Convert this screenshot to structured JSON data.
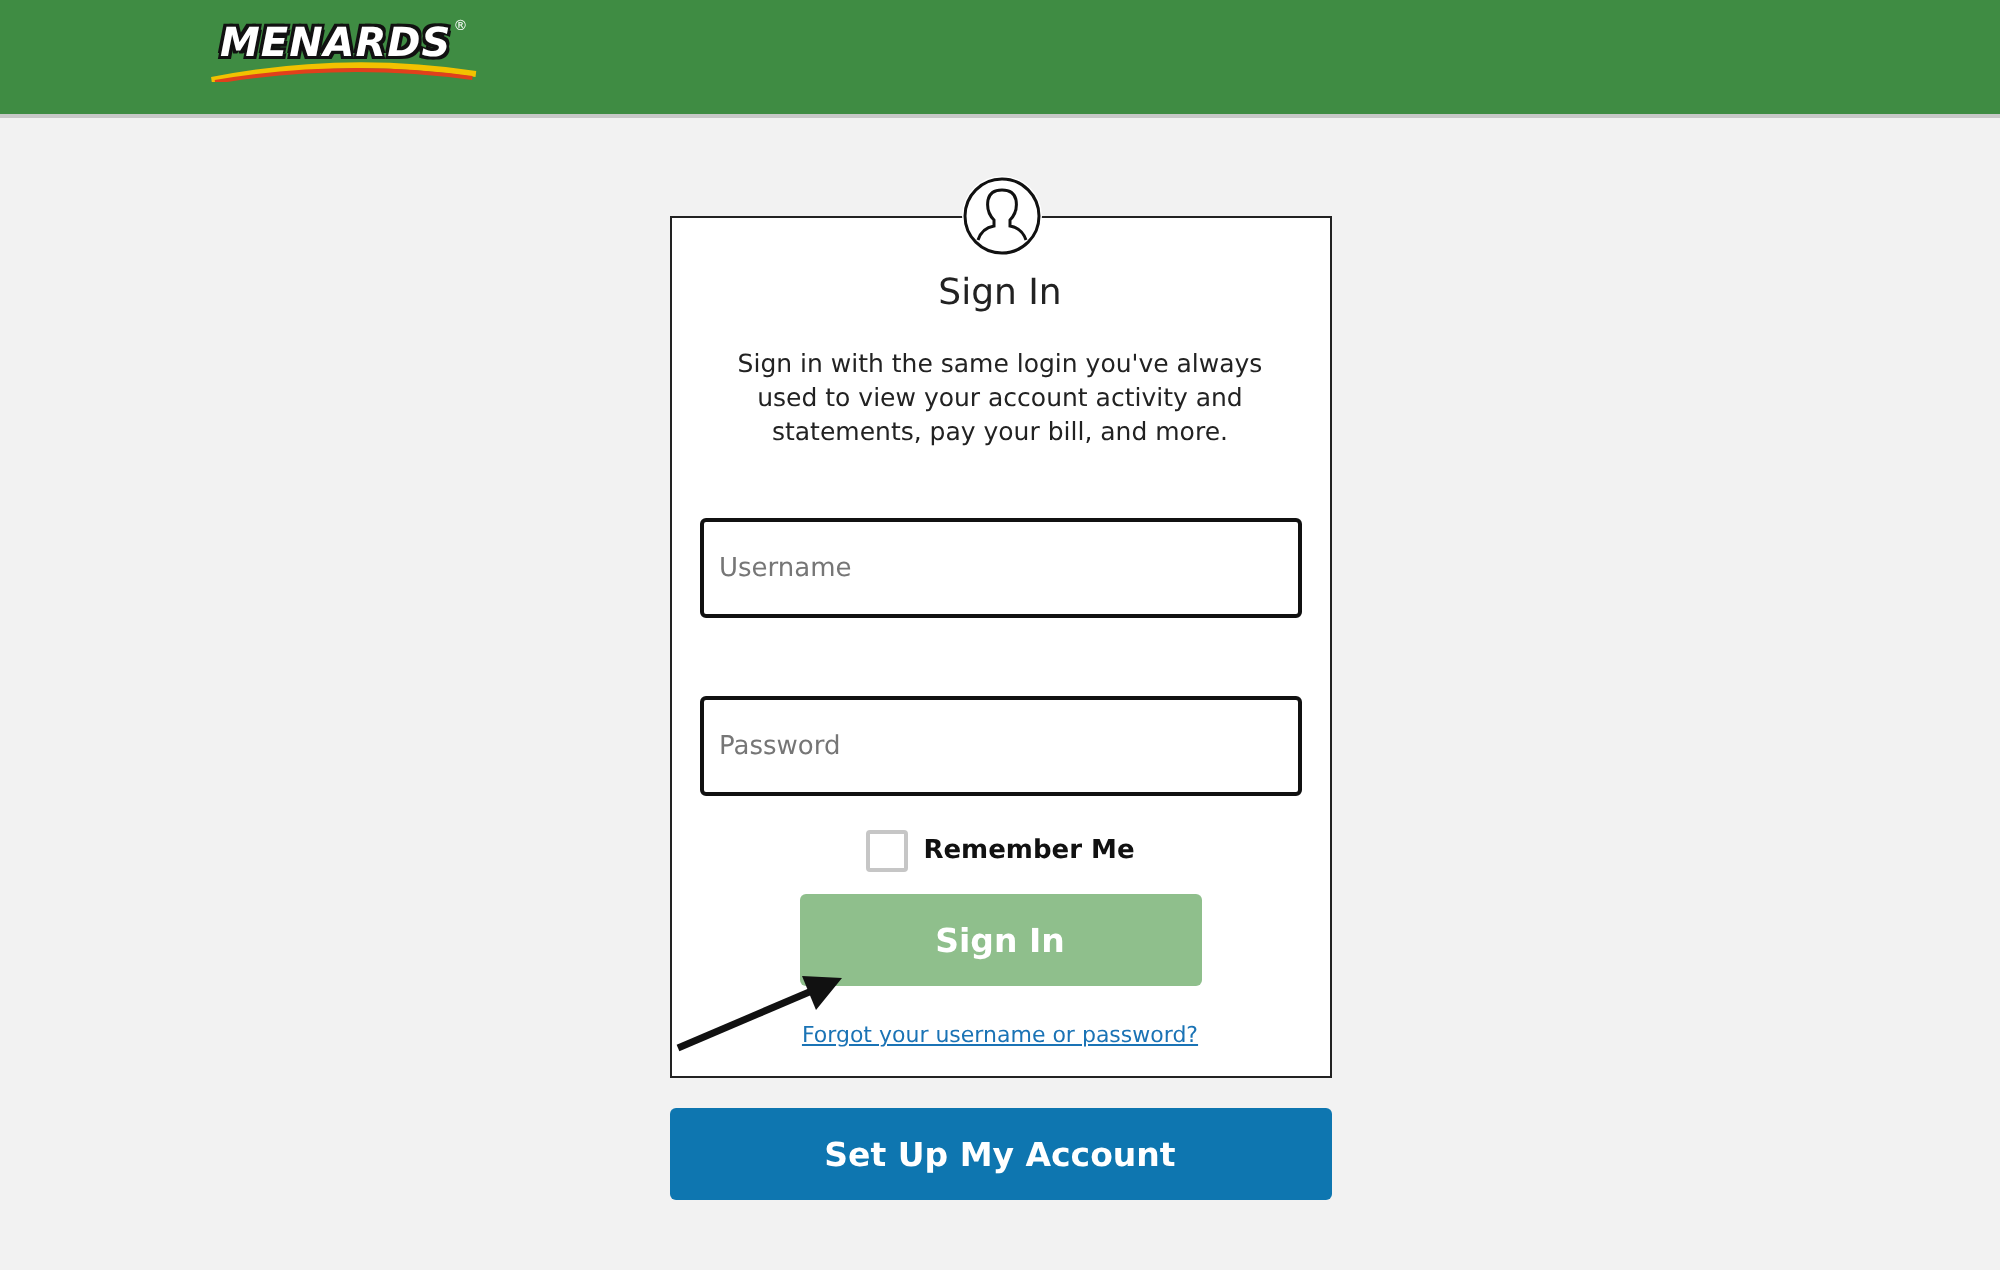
{
  "header": {
    "logo": "MENARDS",
    "logo_mark": "®"
  },
  "sign_in": {
    "title": "Sign In",
    "description": "Sign in with the same login you've always used to view your account activity and statements, pay your bill, and more.",
    "fields": [
      {
        "placeholder": "Username"
      },
      {
        "placeholder": "Password"
      }
    ],
    "remember_me": {
      "label": "Remember Me",
      "checked": false
    },
    "submit": {
      "label": "Sign In",
      "disabled": true
    },
    "forgot_link": "Forgot your username or password?"
  },
  "setup_button": "Set Up My Account"
}
